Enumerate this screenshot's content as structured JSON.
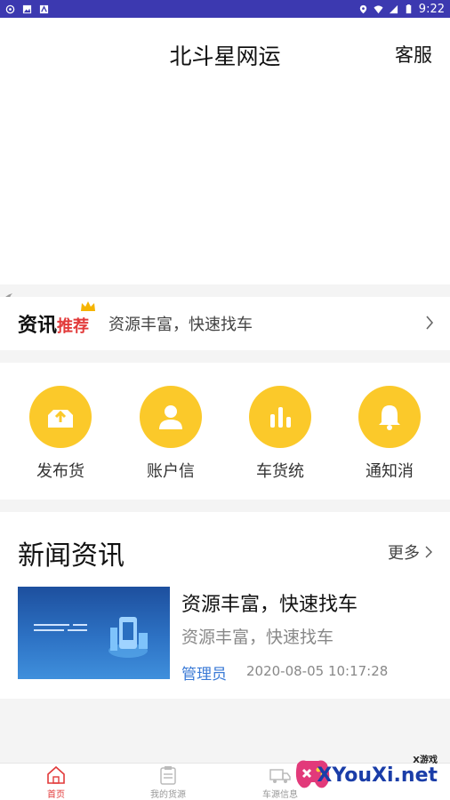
{
  "status_bar": {
    "time": "9:22"
  },
  "header": {
    "title": "北斗星网运",
    "service_label": "客服"
  },
  "info_strip": {
    "brand_main": "资讯",
    "brand_tag": "推荐",
    "text": "资源丰富，快速找车"
  },
  "quick_menu": {
    "items": [
      {
        "label": "发布货",
        "icon": "upload-box-icon"
      },
      {
        "label": "账户信",
        "icon": "person-icon"
      },
      {
        "label": "车货统",
        "icon": "bar-chart-icon"
      },
      {
        "label": "通知消",
        "icon": "bell-icon"
      }
    ]
  },
  "news": {
    "title": "新闻资讯",
    "more_label": "更多",
    "articles": [
      {
        "title": "资源丰富，快速找车",
        "subtitle": "资源丰富，快速找车",
        "author": "管理员",
        "date": "2020-08-05 10:17:28"
      }
    ]
  },
  "tabs": [
    {
      "label": "首页",
      "icon": "home-icon",
      "active": true
    },
    {
      "label": "我的货源",
      "icon": "clipboard-icon",
      "active": false
    },
    {
      "label": "车源信息",
      "icon": "truck-icon",
      "active": false
    }
  ],
  "watermark": {
    "small": "X游戏",
    "big": "XYouXi.net"
  },
  "colors": {
    "status_bar": "#3c39b0",
    "accent_yellow": "#fbc92a",
    "active_red": "#e23a3a",
    "author_blue": "#3a7ad6"
  }
}
